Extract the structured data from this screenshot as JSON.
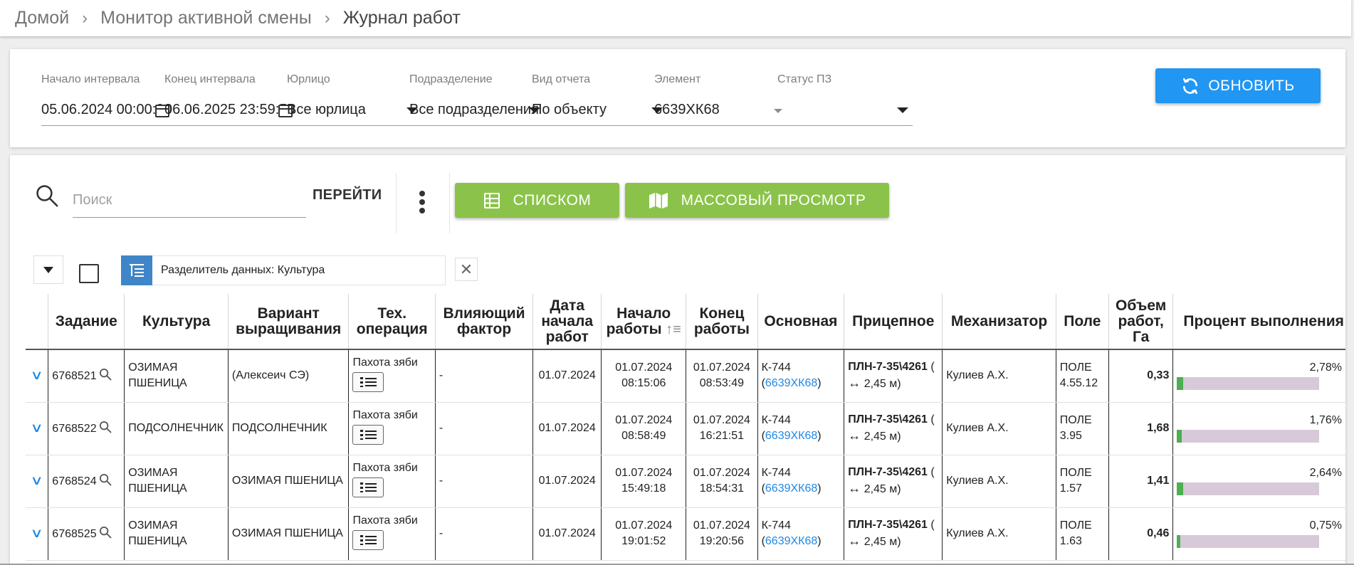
{
  "breadcrumb": {
    "home": "Домой",
    "section": "Монитор активной смены",
    "current": "Журнал работ"
  },
  "filters": {
    "start": {
      "label": "Начало интервала",
      "value": "05.06.2024 00:00:00"
    },
    "end": {
      "label": "Конец интервала",
      "value": "06.06.2025 23:59:59"
    },
    "entity": {
      "label": "Юрлицо",
      "value": "Все юрлица"
    },
    "division": {
      "label": "Подразделение",
      "value": "Все подразделения"
    },
    "report": {
      "label": "Вид отчета",
      "value": "По объекту"
    },
    "element": {
      "label": "Элемент",
      "value": "6639ХК68"
    },
    "status": {
      "label": "Статус ПЗ",
      "value": ""
    },
    "refresh_label": "ОБНОВИТЬ"
  },
  "toolbar": {
    "search_placeholder": "Поиск",
    "go_label": "ПЕРЕЙТИ",
    "list_label": "СПИСКОМ",
    "mass_label": "МАССОВЫЙ ПРОСМОТР",
    "grouping_label": "Разделитель данных: Культура"
  },
  "colors": {
    "primary": "#2196f3",
    "green": "#8bc34a",
    "group_icon": "#3f86c8",
    "link": "#1e88e5",
    "progress_track": "#d8c9d8",
    "progress_fill": "#4caf50"
  },
  "table": {
    "headers": {
      "task": "Задание",
      "culture": "Культура",
      "variant": "Вариант выращивания",
      "operation": "Тех. операция",
      "factor": "Влияющий фактор",
      "date": "Дата начала работ",
      "start": "Начало работы",
      "end": "Конец работы",
      "main": "Основная",
      "trailer": "Прицепное",
      "operator": "Механизатор",
      "field": "Поле",
      "volume": "Объем работ, Га",
      "percent": "Процент выполнения"
    },
    "rows": [
      {
        "task": "6768521",
        "culture": "ОЗИМАЯ ПШЕНИЦА",
        "variant": "(Алексеич СЭ)",
        "operation": "Пахота зяби",
        "factor": "-",
        "date": "01.07.2024",
        "start_date": "01.07.2024",
        "start_time": "08:15:06",
        "end_date": "01.07.2024",
        "end_time": "08:53:49",
        "main_name": "К-744 (",
        "main_link": "6639ХК68",
        "main_close": ")",
        "trailer_name": "ПЛН-7-35\\4261",
        "trailer_open": " (",
        "trailer_width": "2,45 м)",
        "operator": "Кулиев А.Х.",
        "field_name": "ПОЛЕ",
        "field_num": "4.55.12",
        "volume": "0,33",
        "percent_text": "2,78%",
        "percent": 0.0278
      },
      {
        "task": "6768522",
        "culture": "ПОДСОЛНЕЧНИК",
        "variant": "ПОДСОЛНЕЧНИК",
        "operation": "Пахота зяби",
        "factor": "-",
        "date": "01.07.2024",
        "start_date": "01.07.2024",
        "start_time": "08:58:49",
        "end_date": "01.07.2024",
        "end_time": "16:21:51",
        "main_name": "К-744 (",
        "main_link": "6639ХК68",
        "main_close": ")",
        "trailer_name": "ПЛН-7-35\\4261",
        "trailer_open": " (",
        "trailer_width": "2,45 м)",
        "operator": "Кулиев А.Х.",
        "field_name": "ПОЛЕ",
        "field_num": "3.95",
        "volume": "1,68",
        "percent_text": "1,76%",
        "percent": 0.0176
      },
      {
        "task": "6768524",
        "culture": "ОЗИМАЯ ПШЕНИЦА",
        "variant": "ОЗИМАЯ ПШЕНИЦА",
        "operation": "Пахота зяби",
        "factor": "-",
        "date": "01.07.2024",
        "start_date": "01.07.2024",
        "start_time": "15:49:18",
        "end_date": "01.07.2024",
        "end_time": "18:54:31",
        "main_name": "К-744 (",
        "main_link": "6639ХК68",
        "main_close": ")",
        "trailer_name": "ПЛН-7-35\\4261",
        "trailer_open": " (",
        "trailer_width": "2,45 м)",
        "operator": "Кулиев А.Х.",
        "field_name": "ПОЛЕ",
        "field_num": "1.57",
        "volume": "1,41",
        "percent_text": "2,64%",
        "percent": 0.0264
      },
      {
        "task": "6768525",
        "culture": "ОЗИМАЯ ПШЕНИЦА",
        "variant": "ОЗИМАЯ ПШЕНИЦА",
        "operation": "Пахота зяби",
        "factor": "-",
        "date": "01.07.2024",
        "start_date": "01.07.2024",
        "start_time": "19:01:52",
        "end_date": "01.07.2024",
        "end_time": "19:20:56",
        "main_name": "К-744 (",
        "main_link": "6639ХК68",
        "main_close": ")",
        "trailer_name": "ПЛН-7-35\\4261",
        "trailer_open": " (",
        "trailer_width": "2,45 м)",
        "operator": "Кулиев А.Х.",
        "field_name": "ПОЛЕ",
        "field_num": "1.63",
        "volume": "0,46",
        "percent_text": "0,75%",
        "percent": 0.0075
      }
    ]
  }
}
